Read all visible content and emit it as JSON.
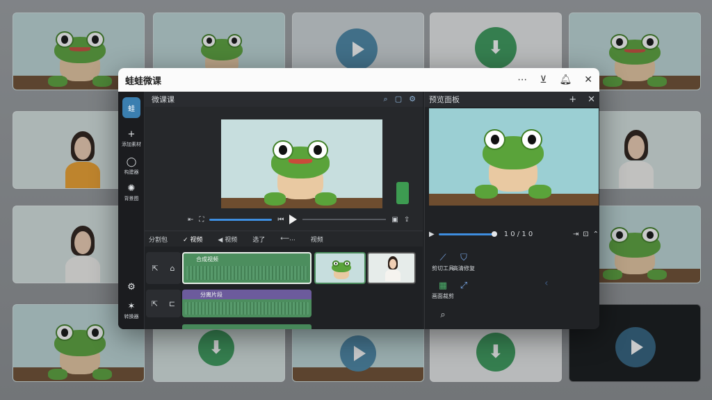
{
  "app": {
    "title": "蛙蛙微课",
    "titlebar_icons": [
      "more-icon",
      "minimize-icon",
      "bell-icon",
      "close-icon"
    ]
  },
  "leftbar": {
    "logo_text": "蛙",
    "items": [
      {
        "label": "添加素材",
        "icon": "plus-icon"
      },
      {
        "label": "构建器",
        "icon": "chat-icon"
      },
      {
        "label": "背景图",
        "icon": "palette-icon"
      },
      {
        "label": "",
        "icon": "settings-icon"
      },
      {
        "label": "转换器",
        "icon": "star-icon"
      }
    ]
  },
  "preview": {
    "header": "微课课",
    "controls": {
      "play": "play-icon"
    }
  },
  "timeline": {
    "tabs": [
      "分割包",
      "✓ 视频",
      "◀ 视频",
      "选了",
      "⟵...",
      "视频"
    ],
    "clip_labels": [
      "合成视频",
      "分离片段"
    ]
  },
  "right_panel": {
    "header": "预览面板",
    "time": "1 0 / 1 0",
    "tools": [
      {
        "label": "剪切工具",
        "icon": "cut-icon"
      },
      {
        "label": "高清修复",
        "icon": "shield-icon"
      },
      {
        "label": "画面裁剪",
        "icon": "crop-icon"
      },
      {
        "label": "",
        "icon": "rotate-icon"
      }
    ],
    "bottom_icon": "search-icon"
  },
  "colors": {
    "accent": "#3e8ee0",
    "clip_green": "#4c8e5e",
    "clip_purple": "#6c5b9c",
    "titlebar": "#fbfbfb",
    "panel": "#222427"
  }
}
